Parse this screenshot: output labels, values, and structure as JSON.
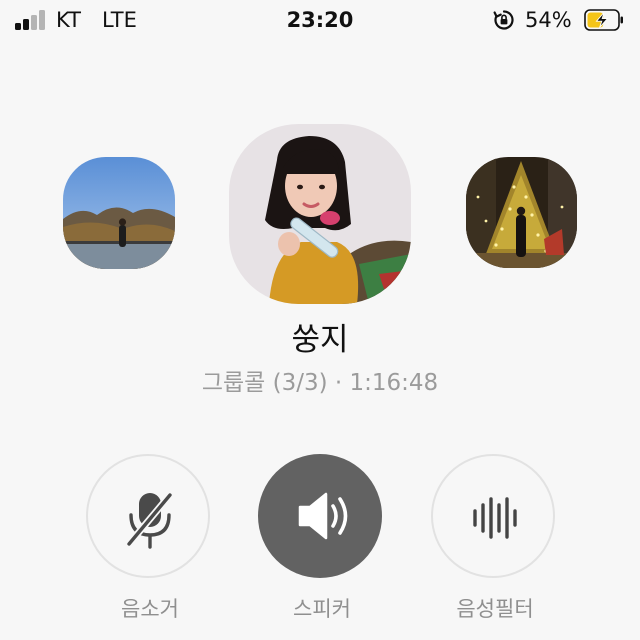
{
  "status_bar": {
    "carrier": "KT",
    "network": "LTE",
    "time": "23:20",
    "battery_percent": "54%",
    "signal_bars_active": 2,
    "signal_bars_total": 4,
    "battery_level": 0.54,
    "battery_charging": true,
    "battery_color": "#f5c518"
  },
  "call": {
    "caller_name": "쑹지",
    "status": "그룹콜 (3/3) · 1:16:48"
  },
  "participants": [
    {
      "name": "left-participant-photo"
    },
    {
      "name": "main-participant-photo"
    },
    {
      "name": "right-participant-photo"
    }
  ],
  "controls": [
    {
      "id": "mute",
      "label": "음소거",
      "icon": "microphone-off-icon",
      "active": false
    },
    {
      "id": "speaker",
      "label": "스피커",
      "icon": "speaker-icon",
      "active": true
    },
    {
      "id": "filter",
      "label": "음성필터",
      "icon": "voice-filter-icon",
      "active": false
    }
  ],
  "colors": {
    "background": "#f7f7f7",
    "active_button": "#626262",
    "inactive_border": "#e2e2e2",
    "label_text": "#8f8f8f",
    "icon_dark": "#444444"
  }
}
